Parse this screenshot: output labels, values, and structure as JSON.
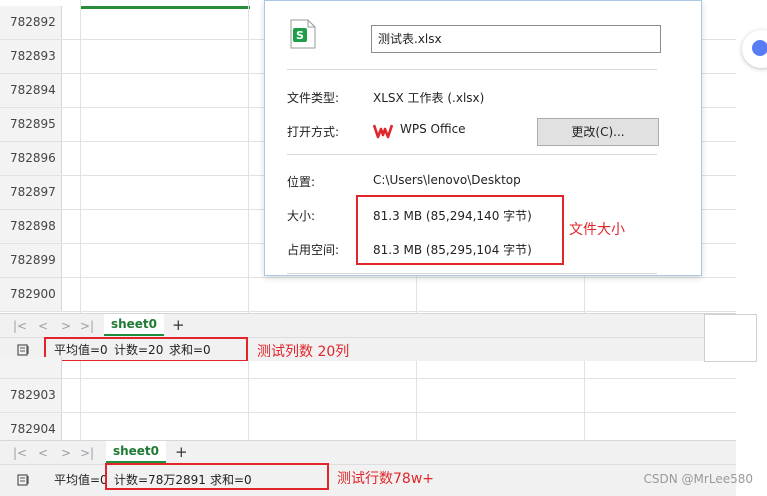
{
  "spreadsheet_top": {
    "row_numbers": [
      "782892",
      "782893",
      "782894",
      "782895",
      "782896",
      "782897",
      "782898",
      "782899",
      "782900"
    ]
  },
  "dialog": {
    "filename": "测试表.xlsx",
    "type_label": "文件类型:",
    "type_value": "XLSX 工作表 (.xlsx)",
    "open_with_label": "打开方式:",
    "open_with_value": "WPS Office",
    "change_button": "更改(C)...",
    "location_label": "位置:",
    "location_value": "C:\\Users\\lenovo\\Desktop",
    "size_label": "大小:",
    "size_value": "81.3 MB (85,294,140 字节)",
    "disk_label": "占用空间:",
    "disk_value": "81.3 MB (85,295,104 字节)"
  },
  "annotations": {
    "file_size": "文件大小",
    "columns_test": "测试列数 20列",
    "rows_test": "测试行数78w+"
  },
  "tabbar_top": {
    "sheet_name": "sheet0",
    "add": "+",
    "nav": [
      "|<",
      "<",
      ">",
      ">|"
    ]
  },
  "status_top": {
    "average": "平均值=0",
    "count": "计数=20",
    "sum": "求和=0"
  },
  "spreadsheet_bottom": {
    "row_numbers": [
      "782903",
      "782904"
    ]
  },
  "tabbar_bottom": {
    "sheet_name": "sheet0",
    "add": "+",
    "nav": [
      "|<",
      "<",
      ">",
      ">|"
    ]
  },
  "status_bottom": {
    "average": "平均值=0",
    "count": "计数=78万2891",
    "sum": "求和=0"
  },
  "watermark": "CSDN @MrLee580",
  "colors": {
    "accent_green": "#1e8f3a",
    "annotation_red": "#e0262b"
  }
}
